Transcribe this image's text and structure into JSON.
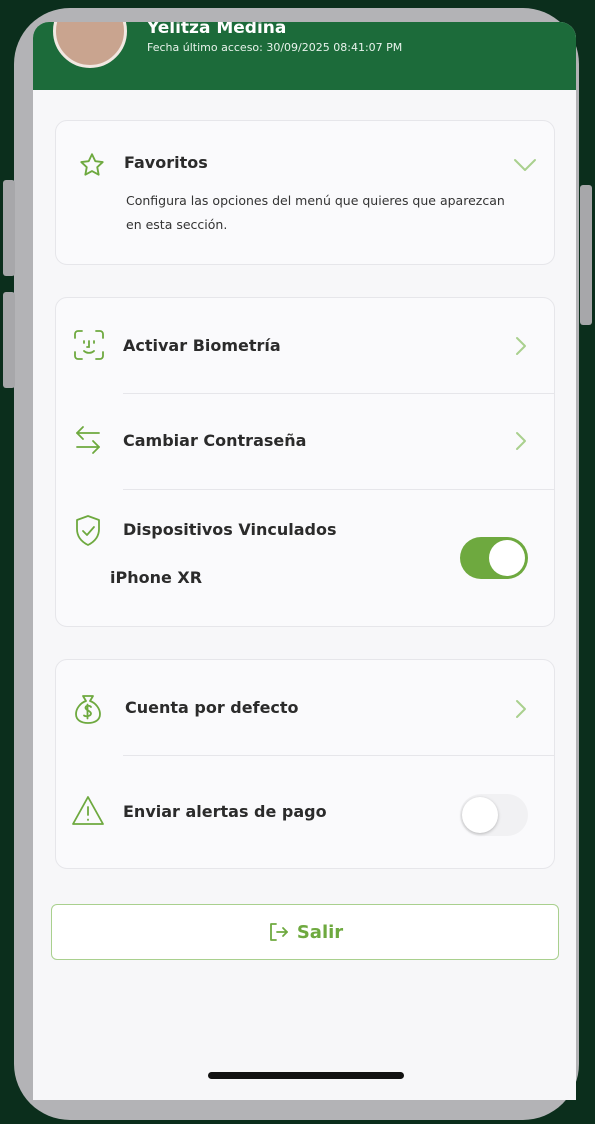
{
  "header": {
    "user_name": "Yelitza Medina",
    "last_access": "Fecha último acceso: 30/09/2025 08:41:07 PM"
  },
  "favorites": {
    "title": "Favoritos",
    "description": "Configura las opciones del menú que quieres que aparezcan en esta sección."
  },
  "security": {
    "biometrics_label": "Activar Biometría",
    "change_password_label": "Cambiar Contraseña",
    "linked_devices_label": "Dispositivos Vinculados",
    "device_name": "iPhone XR",
    "linked_devices_enabled": true
  },
  "account": {
    "default_account_label": "Cuenta por defecto",
    "payment_alerts_label": "Enviar alertas de pago",
    "payment_alerts_enabled": false
  },
  "logout": {
    "label": "Salir"
  },
  "colors": {
    "accent": "#6ea93f",
    "header": "#1c6b3a"
  }
}
